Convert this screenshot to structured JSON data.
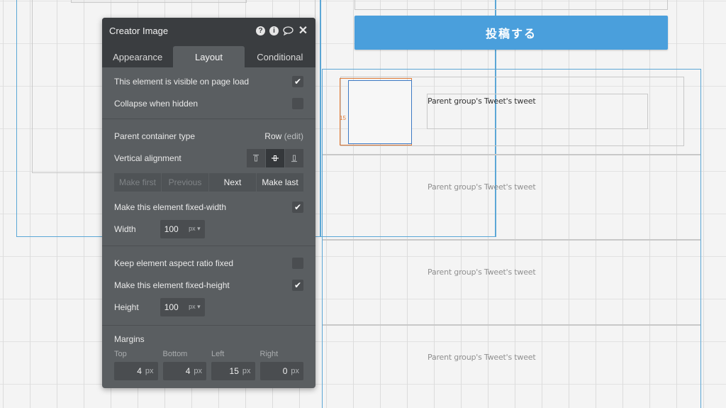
{
  "canvas": {
    "post_button_label": "投稿する",
    "image_margin_badge": "15",
    "tweet_rows": [
      "Parent group's Tweet's tweet",
      "Parent group's Tweet's tweet",
      "Parent group's Tweet's tweet",
      "Parent group's Tweet's tweet"
    ]
  },
  "panel": {
    "title": "Creator Image",
    "header_icons": [
      "help-icon",
      "info-icon",
      "comment-icon",
      "close-icon"
    ],
    "tabs": [
      {
        "label": "Appearance",
        "active": false
      },
      {
        "label": "Layout",
        "active": true
      },
      {
        "label": "Conditional",
        "active": false
      }
    ],
    "visible_on_load": {
      "label": "This element is visible on page load",
      "checked": true
    },
    "collapse_hidden": {
      "label": "Collapse when hidden",
      "checked": false
    },
    "container_type": {
      "label": "Parent container type",
      "value": "Row",
      "edit": "(edit)"
    },
    "vertical_alignment": {
      "label": "Vertical alignment",
      "selected": "center"
    },
    "order_buttons": {
      "make_first": "Make first",
      "previous": "Previous",
      "next": "Next",
      "make_last": "Make last"
    },
    "fixed_width": {
      "label": "Make this element fixed-width",
      "checked": true
    },
    "width": {
      "label": "Width",
      "value": "100",
      "unit": "px"
    },
    "aspect_ratio": {
      "label": "Keep element aspect ratio fixed",
      "checked": false
    },
    "fixed_height": {
      "label": "Make this element fixed-height",
      "checked": true
    },
    "height": {
      "label": "Height",
      "value": "100",
      "unit": "px"
    },
    "margins": {
      "label": "Margins",
      "top_label": "Top",
      "bottom_label": "Bottom",
      "left_label": "Left",
      "right_label": "Right",
      "top": "4",
      "bottom": "4",
      "left": "15",
      "right": "0",
      "unit": "px"
    }
  },
  "colors": {
    "accent_blue": "#4a9fdc",
    "panel_bg": "#5a5e61",
    "panel_header": "#3a3d40",
    "selection_orange": "#e07b39"
  }
}
